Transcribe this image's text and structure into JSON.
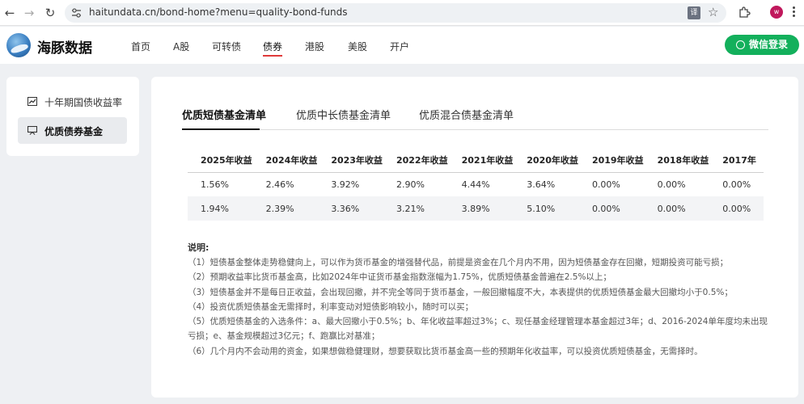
{
  "browser": {
    "url": "haitundata.cn/bond-home?menu=quality-bond-funds",
    "avatar_letter": "w",
    "translate_icon_glyph": "译"
  },
  "header": {
    "logo_text": "海豚数据",
    "nav": [
      "首页",
      "A股",
      "可转债",
      "债券",
      "港股",
      "美股",
      "开户"
    ],
    "active_nav": "债券",
    "login_label": "微信登录"
  },
  "sidebar": {
    "items": [
      {
        "label": "十年期国债收益率",
        "icon": "line-chart-icon",
        "active": false
      },
      {
        "label": "优质债券基金",
        "icon": "presentation-board-icon",
        "active": true
      }
    ]
  },
  "main": {
    "tabs": [
      {
        "label": "优质短债基金清单",
        "active": true
      },
      {
        "label": "优质中长债基金清单",
        "active": false
      },
      {
        "label": "优质混合债基金清单",
        "active": false
      }
    ],
    "table": {
      "headers": [
        "2025年收益",
        "2024年收益",
        "2023年收益",
        "2022年收益",
        "2021年收益",
        "2020年收益",
        "2019年收益",
        "2018年收益",
        "2017年"
      ],
      "rows": [
        [
          "1.56%",
          "2.46%",
          "3.92%",
          "2.90%",
          "4.44%",
          "3.64%",
          "0.00%",
          "0.00%",
          "0.00%"
        ],
        [
          "1.94%",
          "2.39%",
          "3.36%",
          "3.21%",
          "3.89%",
          "5.10%",
          "0.00%",
          "0.00%",
          "0.00%"
        ]
      ]
    },
    "notes": {
      "title": "说明:",
      "lines": [
        "（1）短债基金整体走势稳健向上，可以作为货币基金的增强替代品，前提是资金在几个月内不用，因为短债基金存在回撤，短期投资可能亏损；",
        "（2）预期收益率比货币基金高，比如2024年中证货币基金指数涨幅为1.75%，优质短债基金普遍在2.5%以上；",
        "（3）短债基金并不是每日正收益，会出现回撤，并不完全等同于货币基金，一般回撤幅度不大，本表提供的优质短债基金最大回撤均小于0.5%；",
        "（4）投资优质短债基金无需择时，利率变动对短债影响较小，随时可以买；",
        "（5）优质短债基金的入选条件：a、最大回撤小于0.5%；b、年化收益率超过3%；c、现任基金经理管理本基金超过3年；d、2016-2024单年度均未出现亏损；e、基金规模超过3亿元；f、跑赢比对基准；",
        "（6）几个月内不会动用的资金，如果想做稳健理财，想要获取比货币基金高一些的预期年化收益率，可以投资优质短债基金，无需择时。"
      ]
    }
  }
}
